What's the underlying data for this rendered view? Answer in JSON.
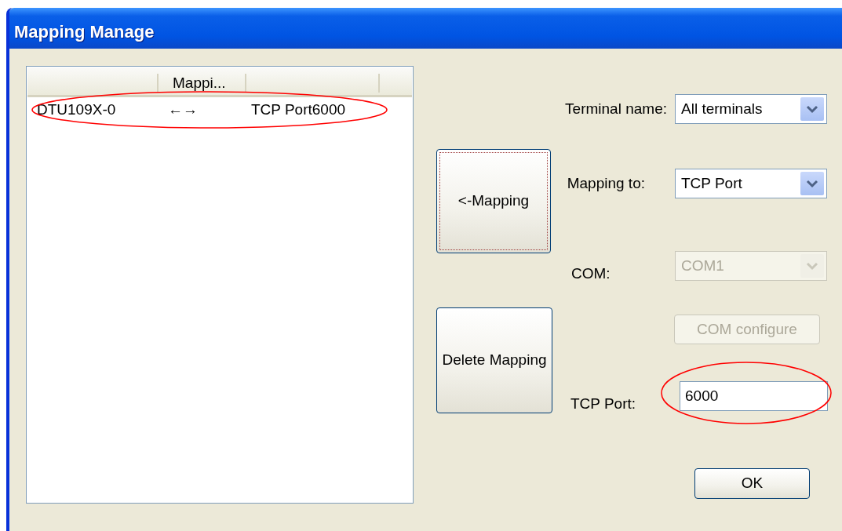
{
  "window": {
    "title": "Mapping Manage"
  },
  "list": {
    "header_label": "Mappi...",
    "rows": [
      {
        "terminal": "DTU109X-0",
        "arrow": "←→",
        "target": "TCP Port6000"
      }
    ]
  },
  "action_buttons": [
    {
      "label": "<-Mapping",
      "focused": true
    },
    {
      "label": "Delete Mapping",
      "focused": false
    }
  ],
  "fields": [
    {
      "kind": "combo",
      "label": "Terminal name:",
      "value": "All terminals",
      "disabled": false
    },
    {
      "kind": "combo",
      "label": "Mapping to:",
      "value": "TCP Port",
      "disabled": false
    },
    {
      "kind": "combo",
      "label": "COM:",
      "value": "COM1",
      "disabled": true
    },
    {
      "kind": "button",
      "label": "COM configure",
      "disabled": true
    },
    {
      "kind": "text",
      "label": "TCP Port:",
      "value": "6000"
    }
  ],
  "ok_button": {
    "label": "OK"
  }
}
